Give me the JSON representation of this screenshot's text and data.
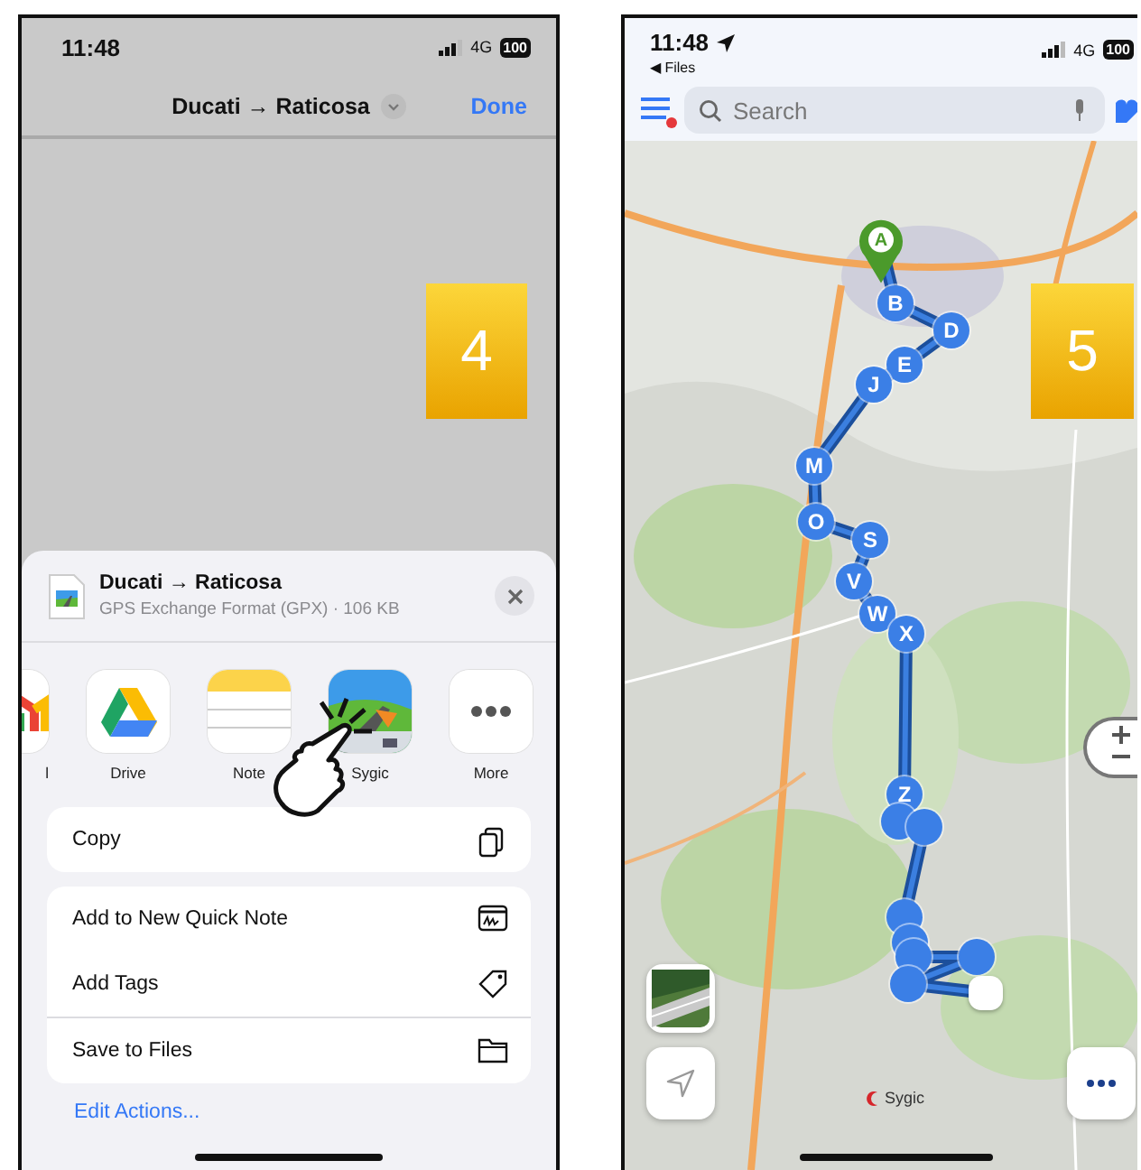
{
  "share_screen": {
    "status_bar": {
      "time": "11:48",
      "network": "4G",
      "battery": "100"
    },
    "nav": {
      "title": "Ducati → Raticosa",
      "done": "Done"
    },
    "step_badge": "4",
    "sheet": {
      "file_title": "Ducati → Raticosa",
      "file_info": "GPS Exchange Format (GPX) · 106 KB",
      "apps": [
        {
          "label": "l",
          "kind": "mail"
        },
        {
          "label": "Drive",
          "kind": "drive"
        },
        {
          "label": "Note",
          "kind": "notes"
        },
        {
          "label": "Sygic",
          "kind": "sygic"
        },
        {
          "label": "More",
          "kind": "more"
        }
      ],
      "action_groups": [
        {
          "items": [
            {
              "label": "Copy",
              "kind": "copy"
            }
          ]
        },
        {
          "items": [
            {
              "label": "Add to New Quick Note",
              "kind": "quicknote"
            },
            {
              "label": "Add Tags",
              "kind": "tag"
            },
            {
              "label": "Save to Files",
              "kind": "folder"
            }
          ]
        }
      ],
      "edit_actions": "Edit Actions..."
    }
  },
  "map_screen": {
    "status_bar": {
      "time": "11:48",
      "back": "◀ Files",
      "network": "4G",
      "battery": "100"
    },
    "menu_badge": true,
    "search": {
      "placeholder": "Search"
    },
    "step_badge": "5",
    "markers": [
      {
        "kind": "start",
        "label": "A"
      },
      {
        "kind": "waypoint",
        "label": "B"
      },
      {
        "kind": "waypoint",
        "label": "D"
      },
      {
        "kind": "waypoint",
        "label": "E"
      },
      {
        "kind": "waypoint",
        "label": "J"
      },
      {
        "kind": "waypoint",
        "label": "M"
      },
      {
        "kind": "waypoint",
        "label": "O"
      },
      {
        "kind": "waypoint",
        "label": "S"
      },
      {
        "kind": "waypoint",
        "label": "V"
      },
      {
        "kind": "waypoint",
        "label": "W"
      },
      {
        "kind": "waypoint",
        "label": "X"
      },
      {
        "kind": "waypoint",
        "label": "Z"
      },
      {
        "kind": "waypoint"
      },
      {
        "kind": "waypoint"
      },
      {
        "kind": "waypoint"
      },
      {
        "kind": "waypoint"
      },
      {
        "kind": "waypoint"
      },
      {
        "kind": "waypoint"
      },
      {
        "kind": "waypoint"
      },
      {
        "kind": "end"
      }
    ],
    "attribution": "Sygic"
  }
}
